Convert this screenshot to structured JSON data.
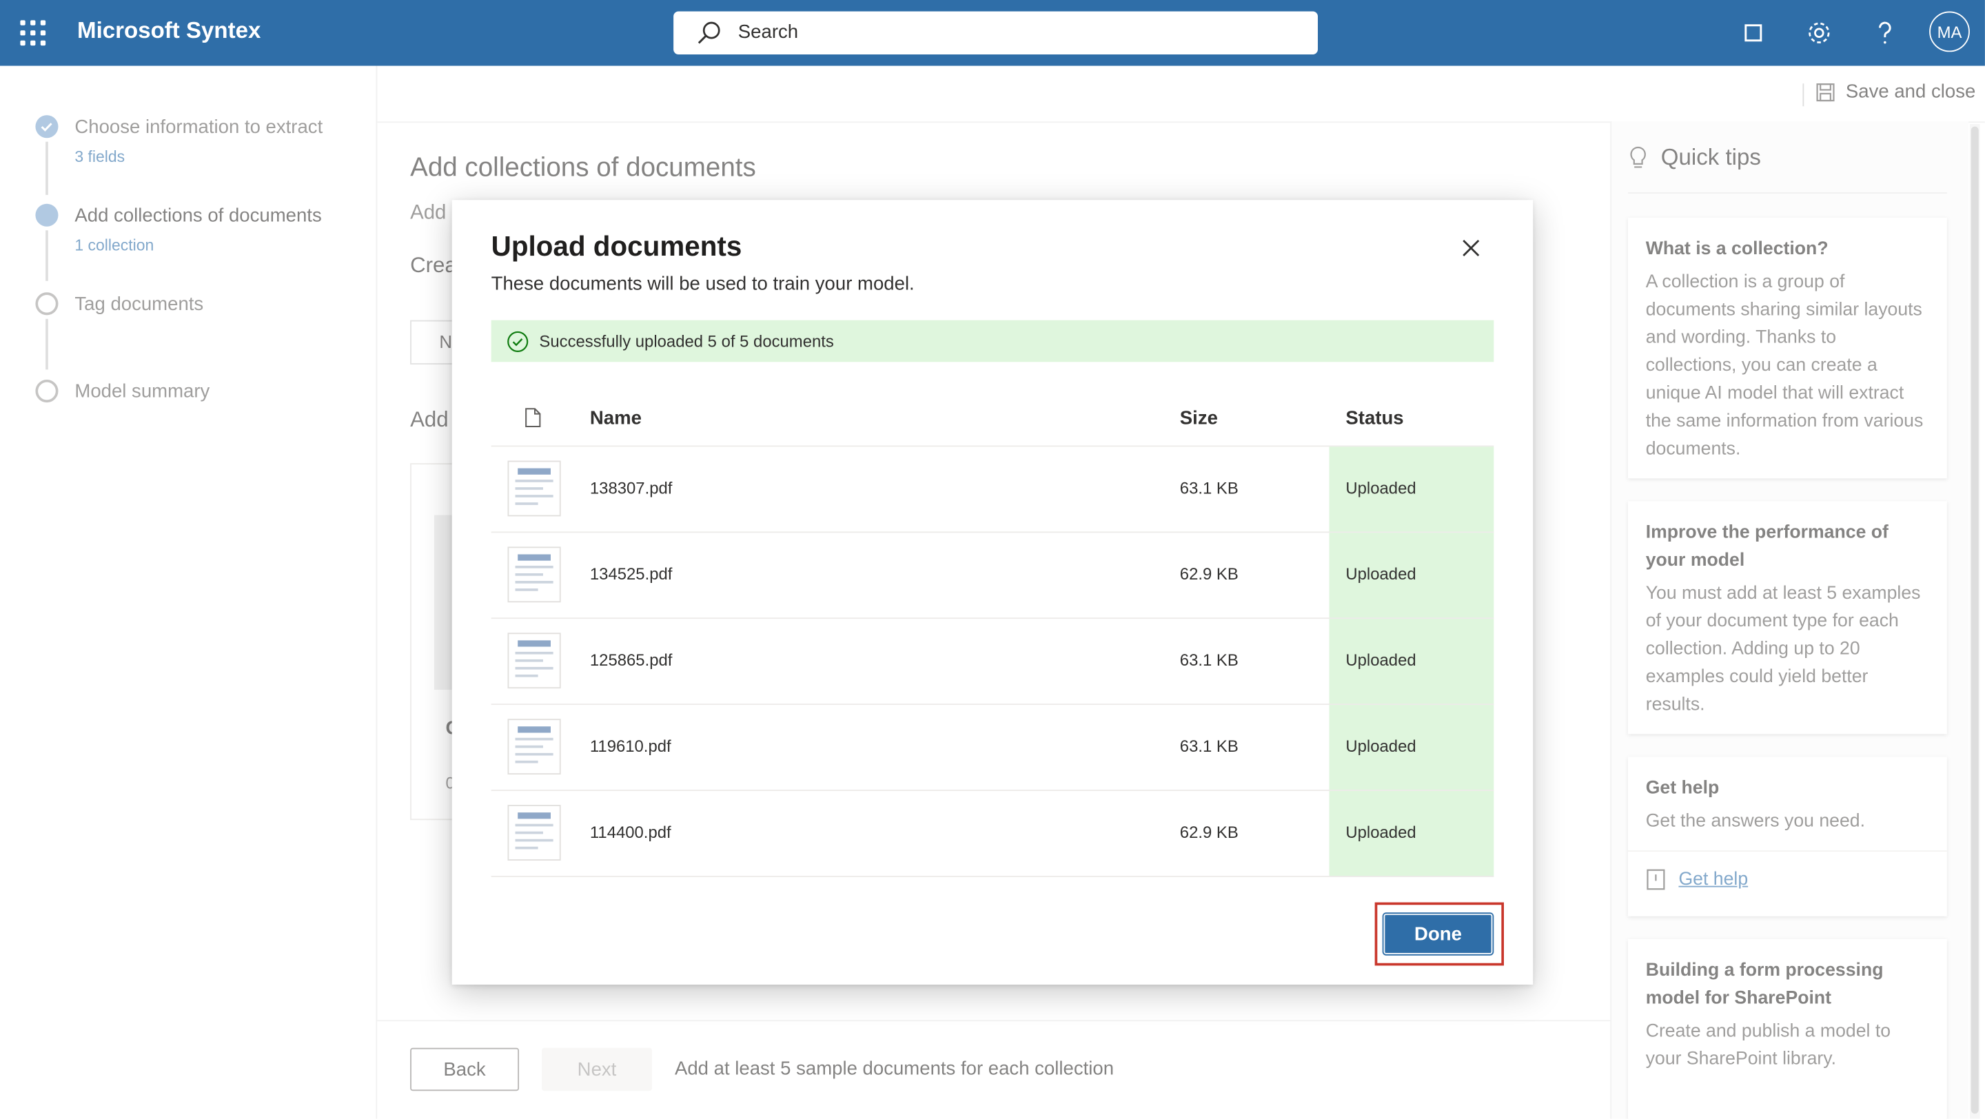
{
  "app": {
    "title": "Microsoft Syntex"
  },
  "search": {
    "placeholder": "Search"
  },
  "avatar": {
    "initials": "MA"
  },
  "toolbar": {
    "save_close_label": "Save and close"
  },
  "steps": [
    {
      "label": "Choose information to extract",
      "sub": "3 fields",
      "state": "completed"
    },
    {
      "label": "Add collections of documents",
      "sub": "1 collection",
      "state": "current"
    },
    {
      "label": "Tag documents",
      "sub": "",
      "state": "pending"
    },
    {
      "label": "Model summary",
      "sub": "",
      "state": "pending"
    }
  ],
  "main": {
    "title": "Add collections of documents",
    "fragments": [
      "Add",
      "Crea",
      "N",
      "Add",
      "C",
      "0"
    ]
  },
  "footer": {
    "back_label": "Back",
    "next_label": "Next",
    "hint": "Add at least 5 sample documents for each collection"
  },
  "tips": {
    "title": "Quick tips",
    "cards": [
      {
        "heading": "What is a collection?",
        "body": "A collection is a group of documents sharing similar layouts and wording. Thanks to collections, you can create a unique AI model that will extract the same information from various documents."
      },
      {
        "heading": "Improve the performance of your model",
        "body": "You must add at least 5 examples of your document type for each collection. Adding up to 20 examples could yield better results."
      },
      {
        "heading": "Get help",
        "body": "Get the answers you need.",
        "link": "Get help"
      },
      {
        "heading": "Building a form processing model for SharePoint",
        "body": "Create and publish a model to your SharePoint library."
      }
    ]
  },
  "dialog": {
    "title": "Upload documents",
    "subtitle": "These documents will be used to train your model.",
    "success_message": "Successfully uploaded 5 of 5 documents",
    "columns": {
      "name": "Name",
      "size": "Size",
      "status": "Status"
    },
    "files": [
      {
        "name": "138307.pdf",
        "size": "63.1 KB",
        "status": "Uploaded"
      },
      {
        "name": "134525.pdf",
        "size": "62.9 KB",
        "status": "Uploaded"
      },
      {
        "name": "125865.pdf",
        "size": "63.1 KB",
        "status": "Uploaded"
      },
      {
        "name": "119610.pdf",
        "size": "63.1 KB",
        "status": "Uploaded"
      },
      {
        "name": "114400.pdf",
        "size": "62.9 KB",
        "status": "Uploaded"
      }
    ],
    "done_label": "Done"
  },
  "colors": {
    "brand": "#2f6ea8",
    "success_bg": "#dff6dd",
    "success_icon": "#107c10",
    "highlight": "#c9372c"
  }
}
